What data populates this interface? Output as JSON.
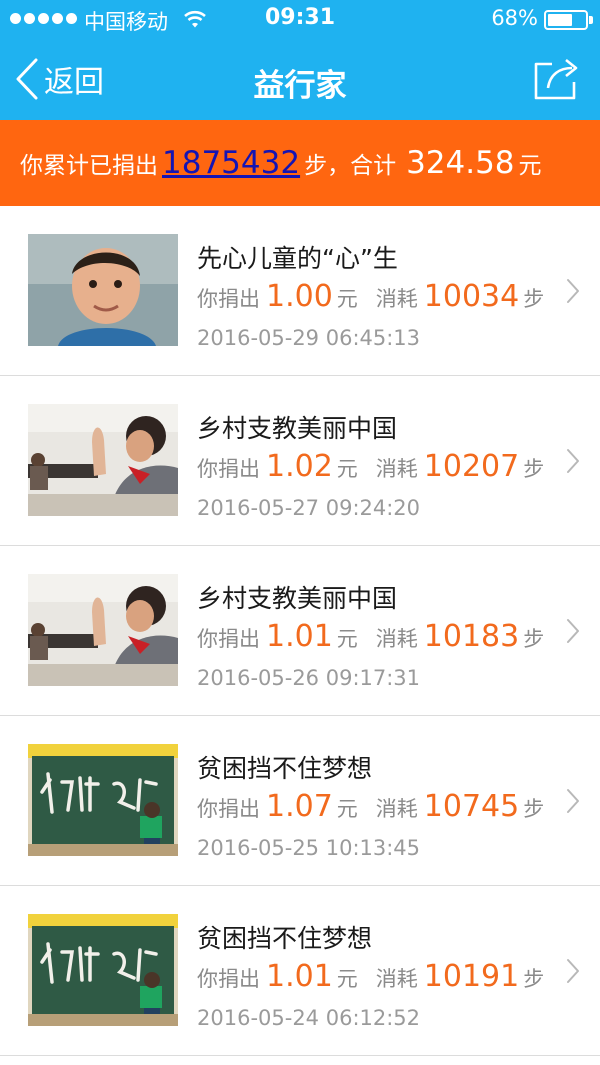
{
  "status_bar": {
    "carrier": "中国移动",
    "time": "09:31",
    "battery": "68%",
    "battery_level": 0.68
  },
  "nav": {
    "back_label": "返回",
    "title": "益行家"
  },
  "summary": {
    "prefix": "你累计已捐出",
    "steps": "1875432",
    "steps_unit": "步，合计",
    "amount": "324.58",
    "amount_unit": "元"
  },
  "labels": {
    "donated": "你捐出",
    "yuan": "元",
    "consumed": "消耗",
    "step": "步"
  },
  "donations": [
    {
      "title": "先心儿童的“心”生",
      "amount": "1.00",
      "steps": "10034",
      "date": "2016-05-29 06:45:13",
      "image": "child-portrait"
    },
    {
      "title": "乡村支教美丽中国",
      "amount": "1.02",
      "steps": "10207",
      "date": "2016-05-27 09:24:20",
      "image": "classroom-boy"
    },
    {
      "title": "乡村支教美丽中国",
      "amount": "1.01",
      "steps": "10183",
      "date": "2016-05-26 09:17:31",
      "image": "classroom-boy"
    },
    {
      "title": "贫困挡不住梦想",
      "amount": "1.07",
      "steps": "10745",
      "date": "2016-05-25 10:13:45",
      "image": "chalkboard"
    },
    {
      "title": "贫困挡不住梦想",
      "amount": "1.01",
      "steps": "10191",
      "date": "2016-05-24 06:12:52",
      "image": "chalkboard"
    }
  ]
}
